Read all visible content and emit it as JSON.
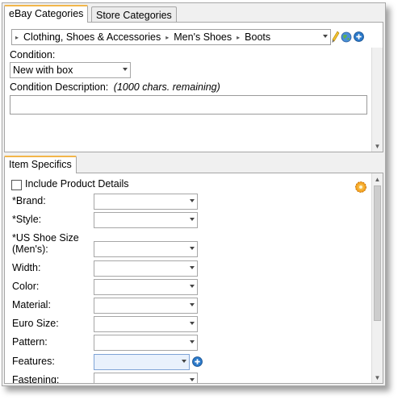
{
  "tabs": {
    "ebay_categories": "eBay Categories",
    "store_categories": "Store Categories"
  },
  "breadcrumb": [
    "Clothing, Shoes & Accessories",
    "Men's Shoes",
    "Boots"
  ],
  "condition": {
    "label": "Condition:",
    "value": "New with box",
    "description_label": "Condition Description:",
    "description_hint": "(1000 chars. remaining)",
    "description_value": ""
  },
  "item_specifics": {
    "tab_label": "Item Specifics",
    "include_product_details": "Include Product Details",
    "include_product_details_checked": false,
    "fields": [
      {
        "label": "*Brand:",
        "value": ""
      },
      {
        "label": "*Style:",
        "value": ""
      },
      {
        "label": "*US Shoe Size (Men's):",
        "value": ""
      },
      {
        "label": "Width:",
        "value": ""
      },
      {
        "label": "Color:",
        "value": ""
      },
      {
        "label": "Material:",
        "value": ""
      },
      {
        "label": "Euro Size:",
        "value": ""
      },
      {
        "label": "Pattern:",
        "value": ""
      },
      {
        "label": "Features:",
        "value": ""
      },
      {
        "label": "Fastening:",
        "value": ""
      }
    ]
  },
  "icons": {
    "edit": "pencil-icon",
    "globe": "globe-icon",
    "add": "add-circle-icon",
    "settings": "gear-icon"
  },
  "colors": {
    "tab_accent": "#f2b64a",
    "panel_border": "#a6a6a6",
    "add_icon": "#2a78c8",
    "highlight_field": "#e9f1fc"
  }
}
